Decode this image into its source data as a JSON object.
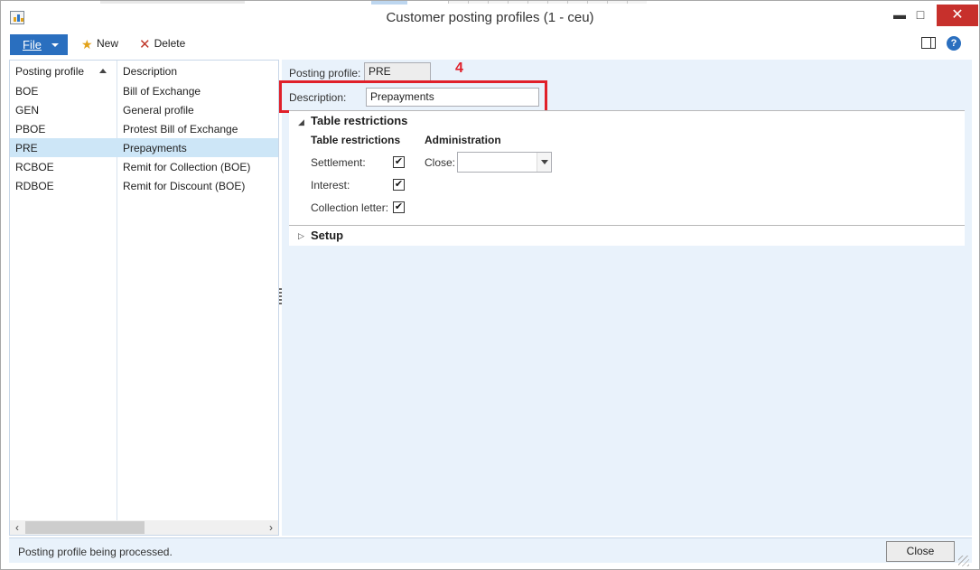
{
  "window": {
    "title": "Customer posting profiles (1 - ceu)",
    "minimize": "▬",
    "maximize": "□",
    "close": "✕"
  },
  "toolbar": {
    "file_label": "File",
    "new_label": "New",
    "delete_label": "Delete",
    "new_icon": "★",
    "delete_icon": "✕"
  },
  "list": {
    "columns": [
      "Posting profile",
      "Description"
    ],
    "rows": [
      {
        "profile": "BOE",
        "description": "Bill of Exchange"
      },
      {
        "profile": "GEN",
        "description": "General profile"
      },
      {
        "profile": "PBOE",
        "description": "Protest Bill of Exchange"
      },
      {
        "profile": "PRE",
        "description": "Prepayments"
      },
      {
        "profile": "RCBOE",
        "description": "Remit for Collection (BOE)"
      },
      {
        "profile": "RDBOE",
        "description": "Remit for Discount (BOE)"
      }
    ],
    "selected_index": 3,
    "scroll_left": "‹",
    "scroll_right": "›"
  },
  "detail": {
    "posting_profile_label": "Posting profile:",
    "posting_profile_value": "PRE",
    "description_label": "Description:",
    "description_value": "Prepayments",
    "callout": "4",
    "table_restrictions": {
      "section_title": "Table restrictions",
      "toggle": "◢",
      "group_title": "Table restrictions",
      "settlement_label": "Settlement:",
      "interest_label": "Interest:",
      "collection_letter_label": "Collection letter:",
      "check_mark": "✔",
      "administration_title": "Administration",
      "close_label": "Close:"
    },
    "setup": {
      "section_title": "Setup",
      "toggle": "▷"
    }
  },
  "status": {
    "message": "Posting profile being processed.",
    "close_button": "Close"
  },
  "help_icon": "?"
}
